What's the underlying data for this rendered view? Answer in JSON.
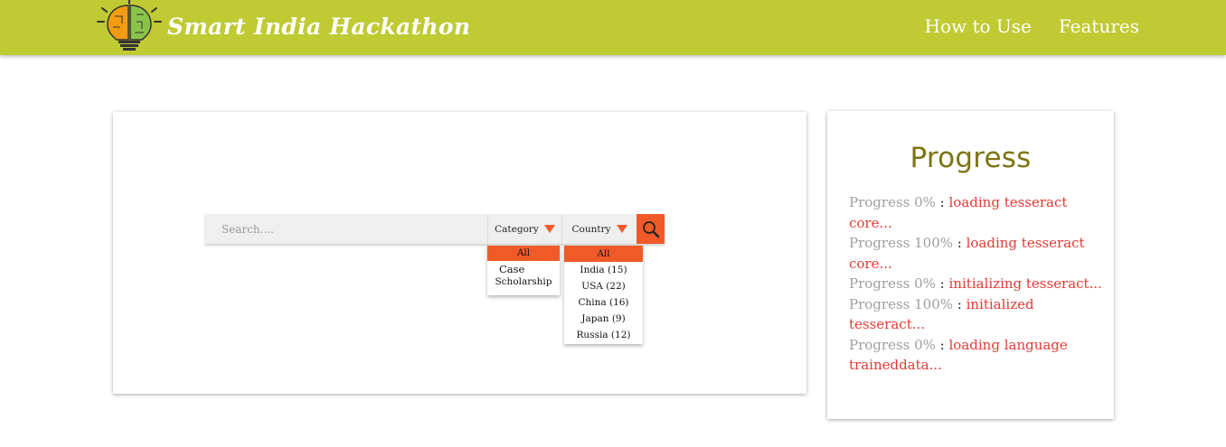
{
  "header": {
    "brand": "Smart India Hackathon",
    "logo_icon": "lightbulb-brain-icon",
    "nav": [
      {
        "label": "How to Use"
      },
      {
        "label": "Features"
      }
    ],
    "colors": {
      "header_bg": "#c0ca33",
      "accent": "#f05a28"
    }
  },
  "search": {
    "placeholder": "Search....",
    "category_label": "Category",
    "country_label": "Country",
    "search_icon": "search-icon"
  },
  "category_dropdown": {
    "options": [
      "All",
      "Case",
      "Scholarship"
    ],
    "selected": "All"
  },
  "country_dropdown": {
    "options": [
      "All",
      "India (15)",
      "USA (22)",
      "China (16)",
      "Japan (9)",
      "Russia (12)"
    ],
    "selected": "All"
  },
  "progress": {
    "title": "Progress",
    "log": [
      {
        "progress": "Progress 0%",
        "sep": " : ",
        "status": "loading tesseract core..."
      },
      {
        "progress": "Progress 100%",
        "sep": " : ",
        "status": "loading tesseract core..."
      },
      {
        "progress": "Progress 0%",
        "sep": " : ",
        "status": "initializing tesseract..."
      },
      {
        "progress": "Progress 100%",
        "sep": " : ",
        "status": "initialized tesseract..."
      },
      {
        "progress": "Progress 0%",
        "sep": " : ",
        "status": "loading language traineddata..."
      }
    ]
  }
}
